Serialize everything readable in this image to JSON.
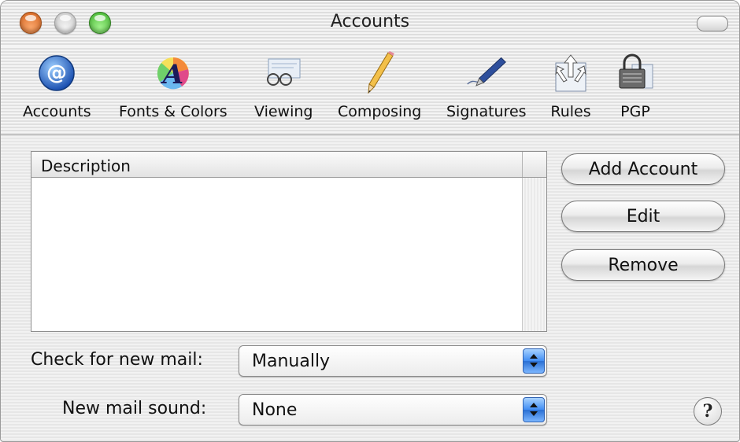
{
  "window": {
    "title": "Accounts"
  },
  "toolbar": {
    "items": [
      {
        "label": "Accounts",
        "icon": "at-sign-icon"
      },
      {
        "label": "Fonts & Colors",
        "icon": "fonts-colors-icon"
      },
      {
        "label": "Viewing",
        "icon": "viewing-glasses-icon"
      },
      {
        "label": "Composing",
        "icon": "pencil-icon"
      },
      {
        "label": "Signatures",
        "icon": "fountain-pen-icon"
      },
      {
        "label": "Rules",
        "icon": "rules-arrows-icon"
      },
      {
        "label": "PGP",
        "icon": "lock-icon"
      }
    ]
  },
  "accounts_list": {
    "column_header": "Description",
    "rows": []
  },
  "buttons": {
    "add_account": "Add Account",
    "edit": "Edit",
    "remove": "Remove"
  },
  "settings": {
    "check_mail_label": "Check for new mail:",
    "check_mail_value": "Manually",
    "sound_label": "New mail sound:",
    "sound_value": "None"
  },
  "help": {
    "glyph": "?"
  }
}
